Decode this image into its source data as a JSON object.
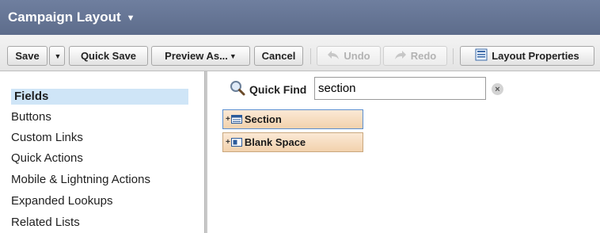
{
  "header": {
    "title": "Campaign Layout"
  },
  "toolbar": {
    "save": "Save",
    "quick_save": "Quick Save",
    "preview_as": "Preview As...",
    "cancel": "Cancel",
    "undo": "Undo",
    "redo": "Redo",
    "layout_properties": "Layout Properties"
  },
  "sidebar": {
    "items": [
      {
        "label": "Fields",
        "active": true
      },
      {
        "label": "Buttons"
      },
      {
        "label": "Custom Links"
      },
      {
        "label": "Quick Actions"
      },
      {
        "label": "Mobile & Lightning Actions"
      },
      {
        "label": "Expanded Lookups"
      },
      {
        "label": "Related Lists"
      }
    ]
  },
  "quick_find": {
    "label": "Quick Find",
    "value": "section"
  },
  "palette": {
    "items": [
      {
        "label": "Section",
        "icon": "section-icon"
      },
      {
        "label": "Blank Space",
        "icon": "blank-space-icon"
      }
    ]
  },
  "colors": {
    "header_bg": "#5d6c8b",
    "active_item": "#cfe5f7",
    "palette_item": "#f2d2ad"
  }
}
